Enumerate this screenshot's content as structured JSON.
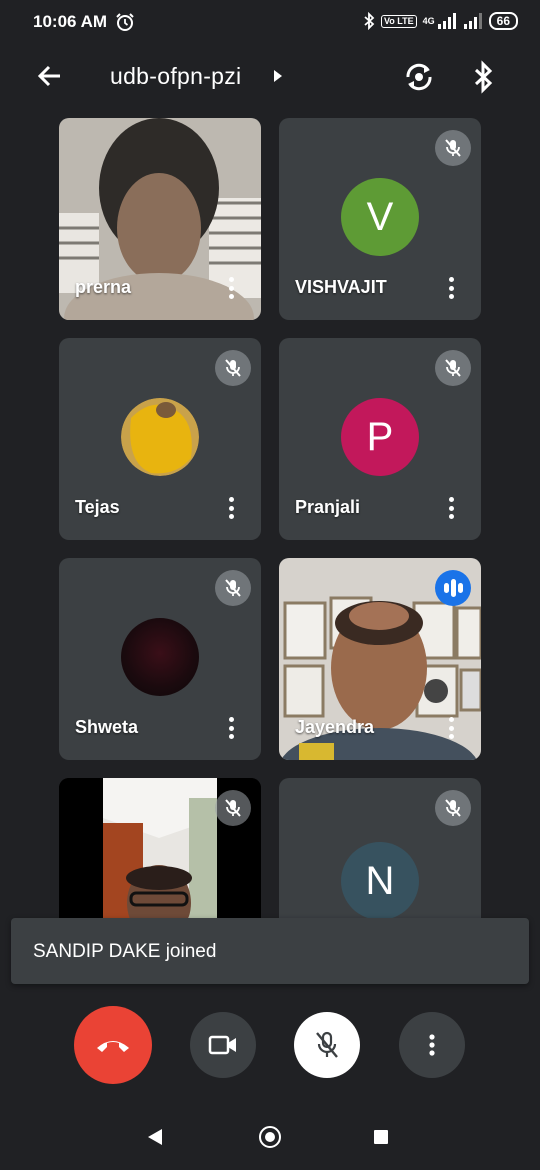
{
  "status_bar": {
    "time": "10:06 AM",
    "volte_badge": "Vo LTE",
    "network": "4G",
    "battery": "66",
    "icons": [
      "alarm-icon",
      "bluetooth-icon",
      "signal-icon",
      "battery-icon"
    ]
  },
  "top_bar": {
    "meeting_code": "udb-ofpn-pzi",
    "icons": [
      "back-arrow-icon",
      "switch-camera-icon",
      "bluetooth-audio-icon"
    ]
  },
  "participants": [
    {
      "name": "prerna",
      "type": "video",
      "muted": false
    },
    {
      "name": "VISHVAJIT",
      "initial": "V",
      "avatar_color": "#5e9b35",
      "muted": true
    },
    {
      "name": "Tejas",
      "type": "photo",
      "muted": true
    },
    {
      "name": "Pranjali",
      "initial": "P",
      "avatar_color": "#c2185b",
      "muted": true
    },
    {
      "name": "Shweta",
      "type": "photo",
      "muted": true
    },
    {
      "name": "Jayendra",
      "type": "video",
      "speaking": true
    },
    {
      "name": "",
      "type": "video",
      "muted": true
    },
    {
      "name": "",
      "initial": "N",
      "avatar_color": "#37525f",
      "muted": true
    }
  ],
  "toast": {
    "message": "SANDIP DAKE joined"
  },
  "controls": {
    "items": [
      "end-call-icon",
      "camera-icon",
      "mic-off-icon",
      "more-options-icon"
    ]
  },
  "colors": {
    "background": "#202124",
    "tile": "#3c4043",
    "end_call": "#ea4335",
    "speaking": "#1a73e8"
  }
}
